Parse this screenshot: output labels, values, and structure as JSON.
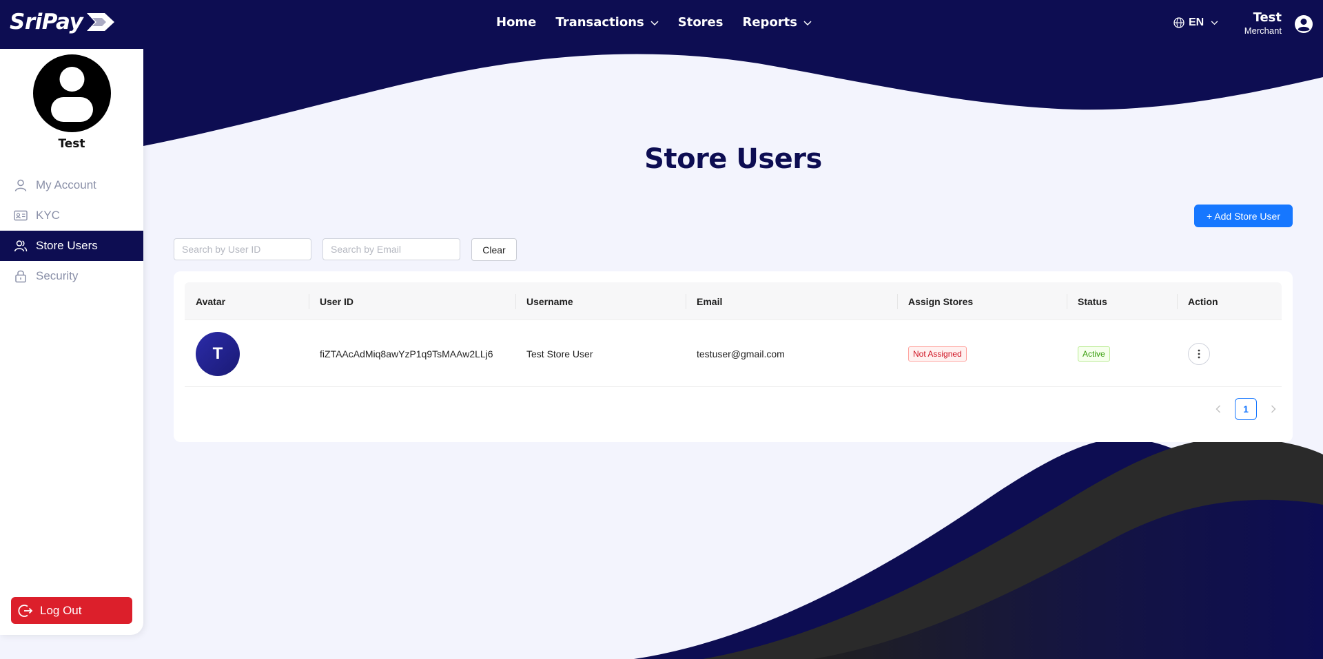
{
  "header": {
    "brand": "SriPay",
    "nav": [
      {
        "label": "Home",
        "has_dropdown": false
      },
      {
        "label": "Transactions",
        "has_dropdown": true
      },
      {
        "label": "Stores",
        "has_dropdown": false
      },
      {
        "label": "Reports",
        "has_dropdown": true
      }
    ],
    "language": "EN",
    "user_name": "Test",
    "user_role": "Merchant"
  },
  "sidebar": {
    "profile_name": "Test",
    "items": [
      {
        "label": "My Account",
        "icon": "user-icon",
        "active": false
      },
      {
        "label": "KYC",
        "icon": "id-card-icon",
        "active": false
      },
      {
        "label": "Store Users",
        "icon": "users-icon",
        "active": true
      },
      {
        "label": "Security",
        "icon": "lock-icon",
        "active": false
      }
    ],
    "logout_label": "Log Out"
  },
  "main": {
    "title": "Store Users",
    "add_button_label": "+ Add Store User",
    "search_user_id_placeholder": "Search by User ID",
    "search_email_placeholder": "Search by Email",
    "clear_label": "Clear",
    "table": {
      "columns": [
        "Avatar",
        "User ID",
        "Username",
        "Email",
        "Assign Stores",
        "Status",
        "Action"
      ],
      "rows": [
        {
          "avatar_letter": "T",
          "user_id": "fiZTAAcAdMiq8awYzP1q9TsMAAw2LLj6",
          "username": "Test Store User",
          "email": "testuser@gmail.com",
          "assign_stores": "Not Assigned",
          "status": "Active"
        }
      ]
    },
    "pagination": {
      "current_page": "1"
    }
  },
  "colors": {
    "navy": "#0d0d52",
    "primary_blue": "#1677ff",
    "logout_red": "#dc1f2b",
    "background": "#f3f4fd",
    "dark_wave": "#2a2a2a"
  }
}
